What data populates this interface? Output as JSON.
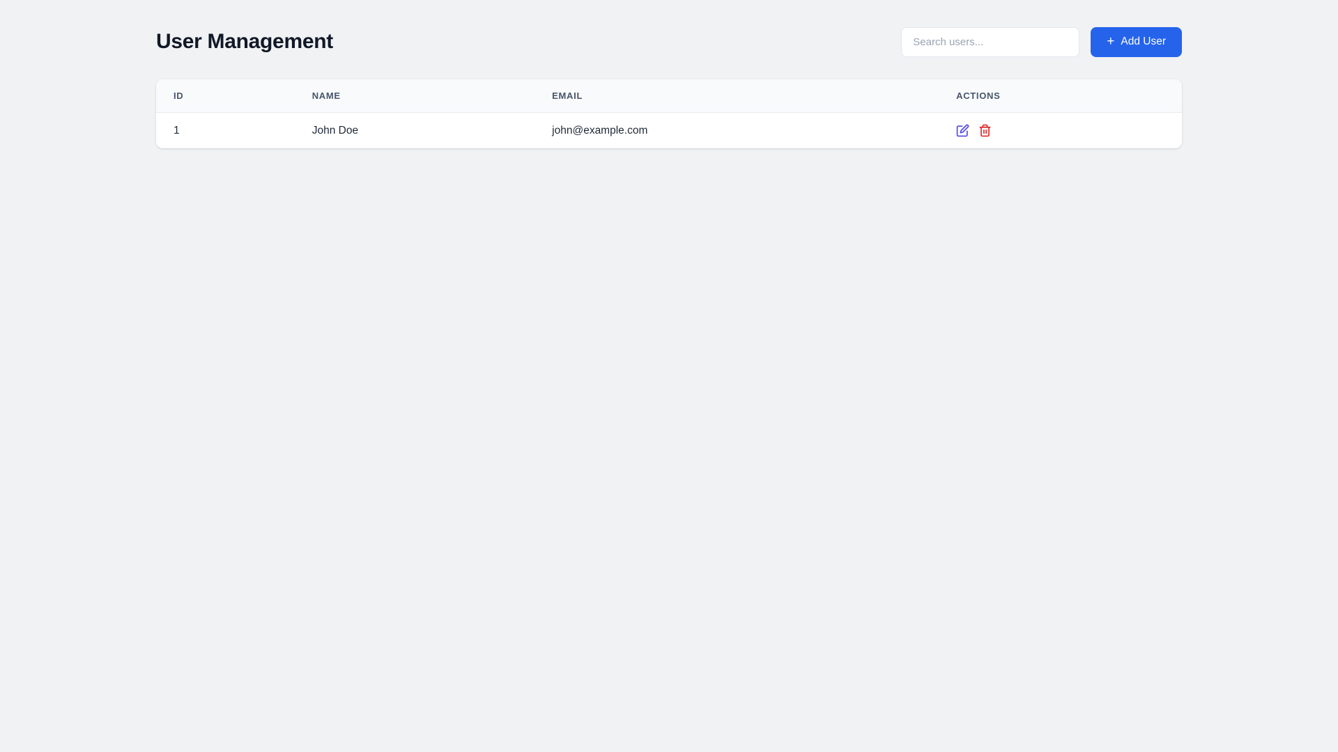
{
  "page": {
    "title": "User Management"
  },
  "search": {
    "placeholder": "Search users..."
  },
  "toolbar": {
    "add_user_label": "Add User",
    "add_user_icon": "+"
  },
  "table": {
    "columns": [
      {
        "label": "ID"
      },
      {
        "label": "NAME"
      },
      {
        "label": "EMAIL"
      },
      {
        "label": "ACTIONS"
      }
    ],
    "rows": [
      {
        "id": "1",
        "name": "John Doe",
        "email": "john@example.com",
        "actions": [
          "edit",
          "delete"
        ]
      }
    ]
  },
  "colors": {
    "accent": "#2563eb",
    "edit_icon": "#4f46e5",
    "delete_icon": "#dc2626",
    "page_bg": "#f1f2f4",
    "header_text": "#475569"
  }
}
